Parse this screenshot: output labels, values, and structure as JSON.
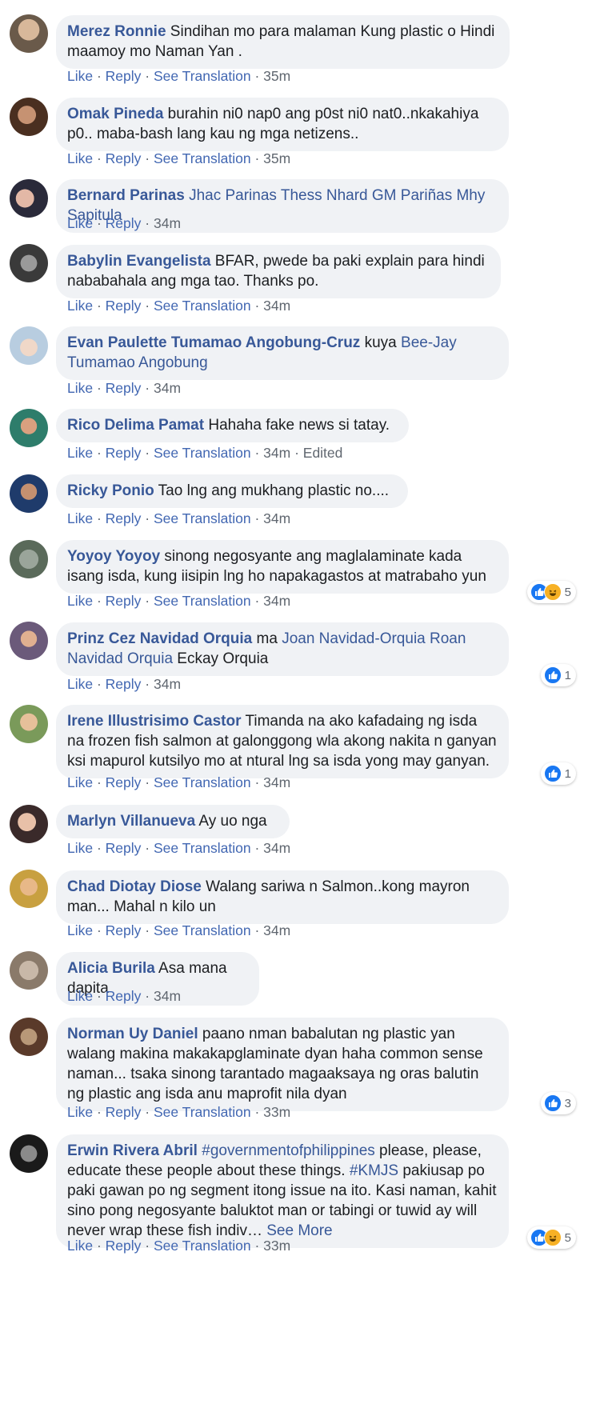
{
  "labels": {
    "like": "Like",
    "reply": "Reply",
    "translate": "See Translation",
    "sep": " · ",
    "edited": "Edited",
    "see_more": "See More"
  },
  "colors": {
    "bubble": "#f0f2f5",
    "link": "#385898",
    "action": "#4267b2",
    "meta": "#606770",
    "like_blue": "#1877f2",
    "haha_yellow": "#f7b125"
  },
  "comments": [
    {
      "author": "Merez Ronnie",
      "text": " Sindihan mo para malaman Kung plastic o Hindi maamoy mo Naman Yan .",
      "time": "35m"
    },
    {
      "author": "Omak Pineda",
      "text": " burahin ni0 nap0 ang p0st ni0 nat0..nkakahiya p0.. maba-bash lang kau ng mga netizens..",
      "time": "35m"
    },
    {
      "author": "Bernard Parinas",
      "tags": "Jhac Parinas Thess Nhard GM Pariñas Mhy Sapitula",
      "time": "34m"
    },
    {
      "author": "Babylin Evangelista",
      "text": " BFAR, pwede ba paki explain para hindi nababahala ang mga tao. Thanks po.",
      "time": "34m"
    },
    {
      "author": "Evan Paulette Tumamao Angobung-Cruz",
      "text": " kuya ",
      "tags": "Bee-Jay Tumamao Angobung",
      "time": "34m"
    },
    {
      "author": "Rico Delima Pamat",
      "text": " Hahaha fake news si tatay.",
      "time": "34m",
      "edited": true
    },
    {
      "author": "Ricky Ponio",
      "text": " Tao lng ang mukhang plastic no....",
      "time": "34m"
    },
    {
      "author": "Yoyoy Yoyoy",
      "text": " sinong negosyante ang maglalaminate kada isang isda, kung iisipin lng ho napakagastos at matrabaho yun",
      "time": "34m",
      "reactions": "5"
    },
    {
      "author": "Prinz Cez Navidad Orquia",
      "text": " ma ",
      "tags": "Joan Navidad-Orquia Roan Navidad Orquia",
      "text2": " Eckay Orquia",
      "time": "34m",
      "reactions": "1"
    },
    {
      "author": "Irene Illustrisimo Castor",
      "text": " Timanda na ako kafadaing ng isda na frozen fish salmon at galonggong wla akong nakita n ganyan ksi mapurol kutsilyo mo at ntural lng sa isda yong may ganyan.",
      "time": "34m",
      "reactions": "1"
    },
    {
      "author": "Marlyn Villanueva",
      "text": " Ay uo nga",
      "time": "34m"
    },
    {
      "author": "Chad Diotay Diose",
      "text": " Walang sariwa n Salmon..kong mayron man... Mahal n kilo un",
      "time": "34m"
    },
    {
      "author": "Alicia Burila",
      "text": " Asa mana dapita",
      "time": "34m"
    },
    {
      "author": "Norman Uy Daniel",
      "text": " paano nman babalutan ng plastic yan walang makina makakapglaminate dyan haha common sense naman... tsaka sinong tarantado magaaksaya ng oras balutin ng plastic ang isda anu maprofit nila dyan",
      "time": "33m",
      "reactions": "3"
    },
    {
      "author": "Erwin Rivera Abril",
      "tags": " #governmentofphilippines",
      "text": " please, please, educate these people about these things. ",
      "tags2": "#KMJS",
      "text2": " pakiusap po paki gawan po ng segment itong issue na ito. Kasi naman, kahit sino pong negosyante baluktot man or tabingi or tuwid ay will never wrap these fish indiv… ",
      "time": "33m",
      "reactions": "5"
    }
  ]
}
